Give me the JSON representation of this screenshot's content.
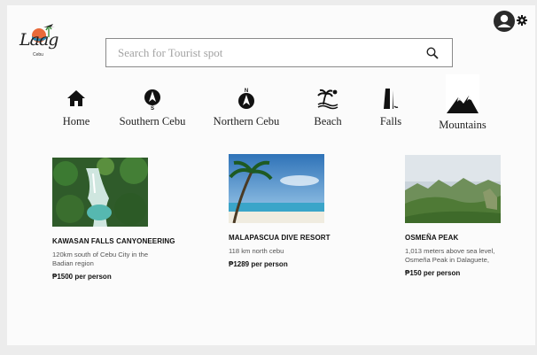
{
  "brand": {
    "logo_text": "Laag",
    "logo_sub": "Cebu"
  },
  "search": {
    "placeholder": "Search for Tourist spot"
  },
  "categories": [
    {
      "label": "Home",
      "icon": "home-icon"
    },
    {
      "label": "Southern Cebu",
      "icon": "compass-south-icon"
    },
    {
      "label": "Northern Cebu",
      "icon": "compass-north-icon"
    },
    {
      "label": "Beach",
      "icon": "beach-icon"
    },
    {
      "label": "Falls",
      "icon": "waterfall-icon"
    },
    {
      "label": "Mountains",
      "icon": "mountains-icon"
    }
  ],
  "spots": [
    {
      "title": "KAWASAN FALLS CANYONEERING",
      "desc": "120km south of Cebu City in the Badian region",
      "price": "₱1500 per person"
    },
    {
      "title": "MALAPASCUA DIVE RESORT",
      "desc": "118 km north cebu",
      "price": "₱1289 per person"
    },
    {
      "title": "OSMEÑA PEAK",
      "desc": "1,013 meters above sea level, Osmeña Peak in Dalaguete,",
      "price": "₱150 per person"
    }
  ],
  "colors": {
    "accent": "#2a2a2a",
    "border": "#8a8a8a",
    "page": "#fbfbfb"
  }
}
